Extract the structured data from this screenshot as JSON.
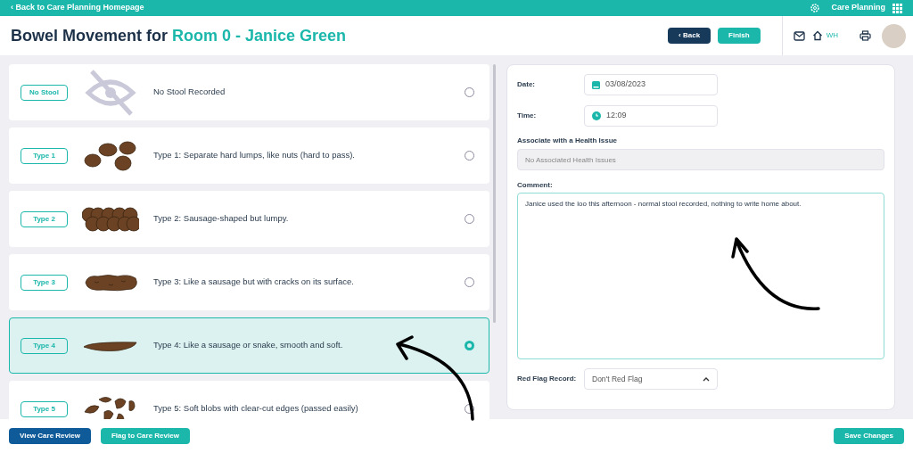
{
  "top_bar": {
    "back_link": "‹ Back to Care Planning Homepage",
    "app_name": "Care Planning"
  },
  "header": {
    "title": "Bowel Movement for",
    "subject": "Room 0 - Janice Green",
    "back_button": "‹ Back",
    "finish_button": "Finish",
    "home_label": "WH"
  },
  "stool_types": [
    {
      "badge": "No Stool",
      "kind": "none",
      "description": "No Stool Recorded",
      "selected": false
    },
    {
      "badge": "Type 1",
      "kind": "lumps",
      "description": "Type 1: Separate hard lumps, like nuts (hard to pass).",
      "selected": false
    },
    {
      "badge": "Type 2",
      "kind": "lumpy",
      "description": "Type 2: Sausage-shaped but lumpy.",
      "selected": false
    },
    {
      "badge": "Type 3",
      "kind": "cracked",
      "description": "Type 3: Like a sausage but with cracks on its surface.",
      "selected": false
    },
    {
      "badge": "Type 4",
      "kind": "smooth",
      "description": "Type 4: Like a sausage or snake, smooth and soft.",
      "selected": true
    },
    {
      "badge": "Type 5",
      "kind": "blobs",
      "description": "Type 5: Soft blobs with clear-cut edges (passed easily)",
      "selected": false
    }
  ],
  "form": {
    "date_label": "Date:",
    "date": "03/08/2023",
    "time_label": "Time:",
    "time": "12:09",
    "health_issue_label": "Associate with a Health Issue",
    "health_issue_placeholder": "No Associated Health Issues",
    "comment_label": "Comment:",
    "comment": "Janice used the loo this afternoon - normal stool recorded, nothing to write home about.",
    "red_flag_label": "Red Flag Record:",
    "red_flag_value": "Don't Red Flag"
  },
  "footer": {
    "view_button": "View Care Review",
    "flag_button": "Flag to Care Review",
    "save_button": "Save Changes"
  }
}
